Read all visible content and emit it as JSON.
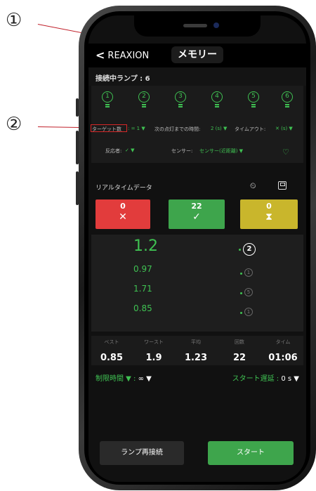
{
  "annotations": {
    "marker_1": "①",
    "marker_2": "②"
  },
  "nav": {
    "back_label": "REAXION",
    "title": "メモリー"
  },
  "connection": {
    "label": "接続中ランプ : 6"
  },
  "lamps": [
    "1",
    "2",
    "3",
    "4",
    "5",
    "6"
  ],
  "settings": {
    "target_label": "ターゲット数",
    "target_value": ": = 1 ▼",
    "next_light_label": "次の点灯までの時間:",
    "next_light_value": "2 (s) ▼",
    "timeout_label": "タイムアウト:",
    "timeout_value": "✕ (s) ▼",
    "reactor_label": "反応者:",
    "reactor_value": "✓ ▼",
    "sensor_label": "センサー:",
    "sensor_value": "センサー(近距離) ▼",
    "heart_icon": "♡"
  },
  "realtime": {
    "title": "リアルタイムデータ",
    "history_icon": "history-icon",
    "save_icon": "save-icon"
  },
  "tiles": [
    {
      "count": "0",
      "symbol": "✕",
      "color": "#e23c3c"
    },
    {
      "count": "22",
      "symbol": "✓",
      "color": "#3ea54c"
    },
    {
      "count": "0",
      "symbol": "⧗",
      "color": "#c9b62c"
    }
  ],
  "times": [
    {
      "value": "1.2",
      "lamp": "2"
    },
    {
      "value": "0.97",
      "lamp": "1"
    },
    {
      "value": "1.71",
      "lamp": "5"
    },
    {
      "value": "0.85",
      "lamp": "1"
    }
  ],
  "stats": {
    "labels": [
      "ベスト",
      "ワースト",
      "平均",
      "回数",
      "タイム"
    ],
    "values": [
      "0.85",
      "1.9",
      "1.23",
      "22",
      "01:06"
    ]
  },
  "limits": {
    "time_limit_label": "制限時間 ▼ :",
    "time_limit_value": "∞ ▼",
    "start_delay_label": "スタート遅延 :",
    "start_delay_value": "0 s ▼"
  },
  "buttons": {
    "reconnect": "ランプ再接続",
    "start": "スタート"
  },
  "colors": {
    "accent_green": "#3fc152",
    "error_red": "#e23c3c",
    "timeout_yellow": "#c9b62c",
    "callout_red": "#c0202a"
  }
}
